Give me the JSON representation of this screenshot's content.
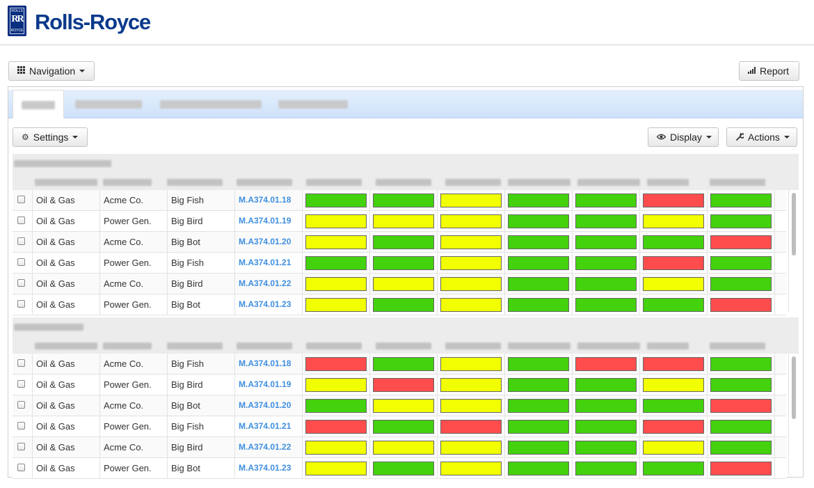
{
  "brand": {
    "name": "Rolls-Royce",
    "badge_top": "ROLLS",
    "badge_mono": "RR",
    "badge_bottom": "ROYCE"
  },
  "toolbar": {
    "navigation_label": "Navigation",
    "report_label": "Report"
  },
  "panel_toolbar": {
    "settings_label": "Settings",
    "display_label": "Display",
    "actions_label": "Actions"
  },
  "colors": {
    "green": "#44d10e",
    "yellow": "#f1ff00",
    "red": "#ff4d4d",
    "link": "#3f8fe0",
    "brand": "#0b3a8c"
  },
  "sections": [
    {
      "rows": [
        {
          "sector": "Oil & Gas",
          "company": "Acme Co.",
          "asset": "Big Fish",
          "code": "M.A374.01.18",
          "status": [
            "green",
            "green",
            "yellow",
            "green",
            "green",
            "red",
            "green"
          ]
        },
        {
          "sector": "Oil & Gas",
          "company": "Power Gen.",
          "asset": "Big Bird",
          "code": "M.A374.01.19",
          "status": [
            "yellow",
            "yellow",
            "yellow",
            "green",
            "green",
            "yellow",
            "green"
          ]
        },
        {
          "sector": "Oil & Gas",
          "company": "Acme Co.",
          "asset": "Big Bot",
          "code": "M.A374.01.20",
          "status": [
            "yellow",
            "green",
            "yellow",
            "green",
            "green",
            "green",
            "red"
          ]
        },
        {
          "sector": "Oil & Gas",
          "company": "Power Gen.",
          "asset": "Big Fish",
          "code": "M.A374.01.21",
          "status": [
            "green",
            "green",
            "yellow",
            "green",
            "green",
            "red",
            "green"
          ]
        },
        {
          "sector": "Oil & Gas",
          "company": "Acme Co.",
          "asset": "Big Bird",
          "code": "M.A374.01.22",
          "status": [
            "yellow",
            "yellow",
            "yellow",
            "green",
            "green",
            "yellow",
            "green"
          ]
        },
        {
          "sector": "Oil & Gas",
          "company": "Power Gen.",
          "asset": "Big Bot",
          "code": "M.A374.01.23",
          "status": [
            "yellow",
            "green",
            "yellow",
            "green",
            "green",
            "green",
            "red"
          ]
        }
      ]
    },
    {
      "rows": [
        {
          "sector": "Oil & Gas",
          "company": "Acme Co.",
          "asset": "Big Fish",
          "code": "M.A374.01.18",
          "status": [
            "red",
            "green",
            "yellow",
            "green",
            "red",
            "red",
            "green"
          ]
        },
        {
          "sector": "Oil & Gas",
          "company": "Power Gen.",
          "asset": "Big Bird",
          "code": "M.A374.01.19",
          "status": [
            "yellow",
            "red",
            "yellow",
            "green",
            "green",
            "yellow",
            "green"
          ]
        },
        {
          "sector": "Oil & Gas",
          "company": "Acme Co.",
          "asset": "Big Bot",
          "code": "M.A374.01.20",
          "status": [
            "green",
            "yellow",
            "yellow",
            "green",
            "green",
            "green",
            "red"
          ]
        },
        {
          "sector": "Oil & Gas",
          "company": "Power Gen.",
          "asset": "Big Fish",
          "code": "M.A374.01.21",
          "status": [
            "red",
            "green",
            "red",
            "green",
            "green",
            "red",
            "green"
          ]
        },
        {
          "sector": "Oil & Gas",
          "company": "Acme Co.",
          "asset": "Big Bird",
          "code": "M.A374.01.22",
          "status": [
            "yellow",
            "yellow",
            "yellow",
            "green",
            "green",
            "yellow",
            "green"
          ]
        },
        {
          "sector": "Oil & Gas",
          "company": "Power Gen.",
          "asset": "Big Bot",
          "code": "M.A374.01.23",
          "status": [
            "yellow",
            "green",
            "yellow",
            "green",
            "green",
            "green",
            "red"
          ]
        }
      ]
    }
  ]
}
